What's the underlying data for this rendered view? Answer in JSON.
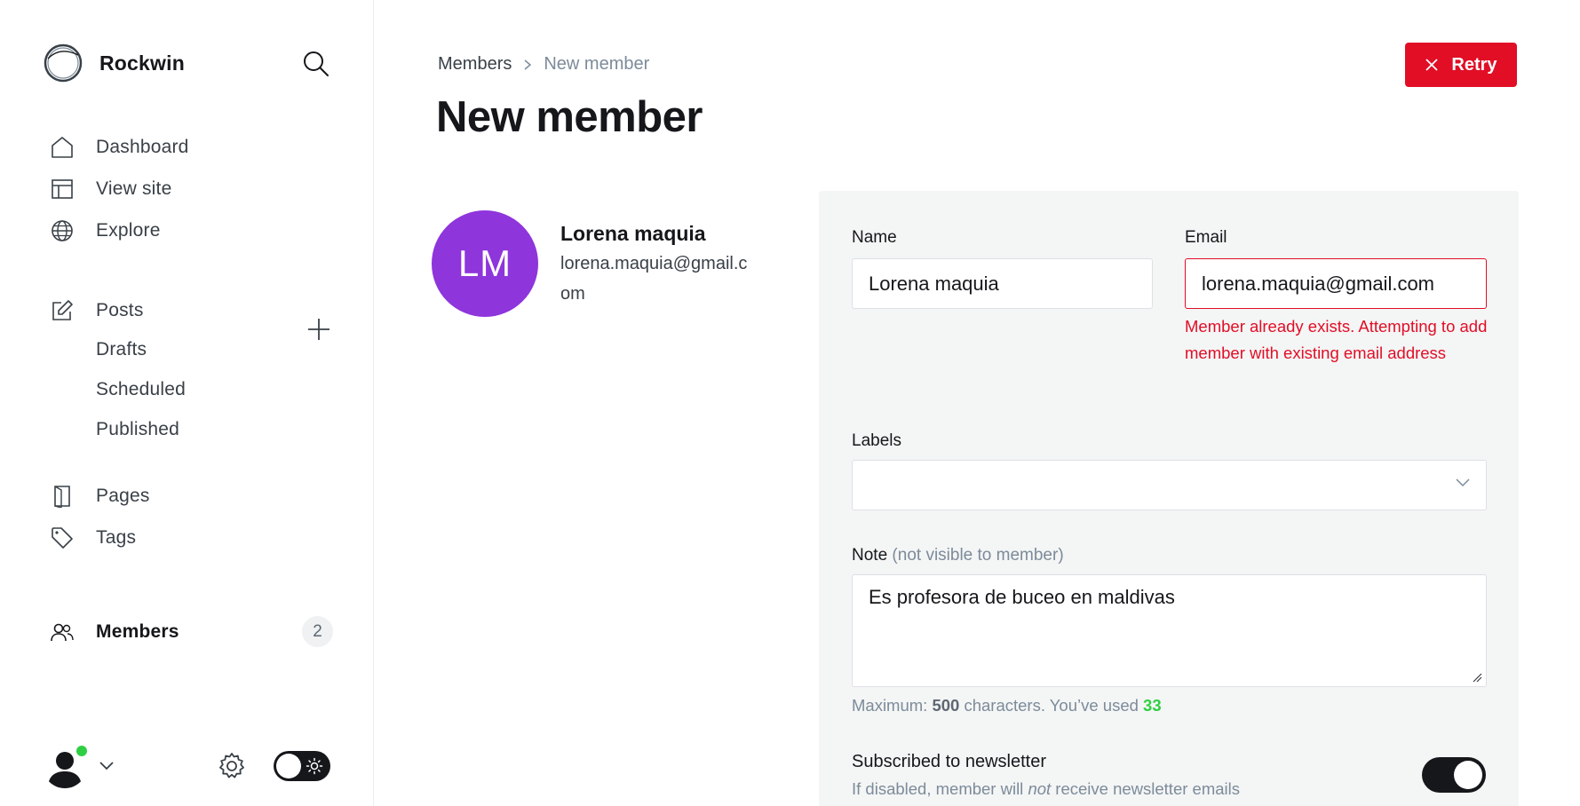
{
  "sidebar": {
    "brand": "Rockwin",
    "nav": {
      "dashboard": "Dashboard",
      "view_site": "View site",
      "explore": "Explore",
      "posts": "Posts",
      "drafts": "Drafts",
      "scheduled": "Scheduled",
      "published": "Published",
      "pages": "Pages",
      "tags": "Tags",
      "members": "Members",
      "members_count": "2"
    },
    "icons": [
      "search-icon",
      "home-icon",
      "layout-icon",
      "globe-icon",
      "edit-icon",
      "plus-icon",
      "page-icon",
      "tag-icon",
      "members-icon",
      "gear-icon",
      "sun-icon",
      "chevron-down-icon"
    ],
    "colors": {
      "online": "#30cf43"
    }
  },
  "header": {
    "breadcrumb": {
      "parent": "Members",
      "current": "New member"
    },
    "title": "New member",
    "retry_label": "Retry"
  },
  "member": {
    "initials": "LM",
    "name": "Lorena maquia",
    "email": "lorena.maquia@gmail.com",
    "avatar_color": "#8e35dc"
  },
  "form": {
    "name_label": "Name",
    "name_value": "Lorena maquia",
    "email_label": "Email",
    "email_value": "lorena.maquia@gmail.com",
    "email_error": "Member already exists. Attempting to add member with existing email address",
    "labels_label": "Labels",
    "labels_value": "",
    "note_label": "Note",
    "note_hint": "(not visible to member)",
    "note_value": "Es profesora de buceo en maldivas",
    "char_prefix": "Maximum: ",
    "char_max": "500",
    "char_middle": " characters. You’ve used ",
    "char_used": "33",
    "newsletter_title": "Subscribed to newsletter",
    "newsletter_desc_pre": "If disabled, member will ",
    "newsletter_desc_em": "not",
    "newsletter_desc_post": " receive newsletter emails",
    "newsletter_enabled": true
  },
  "colors": {
    "accent_red": "#e10e26",
    "dark": "#15171a"
  }
}
